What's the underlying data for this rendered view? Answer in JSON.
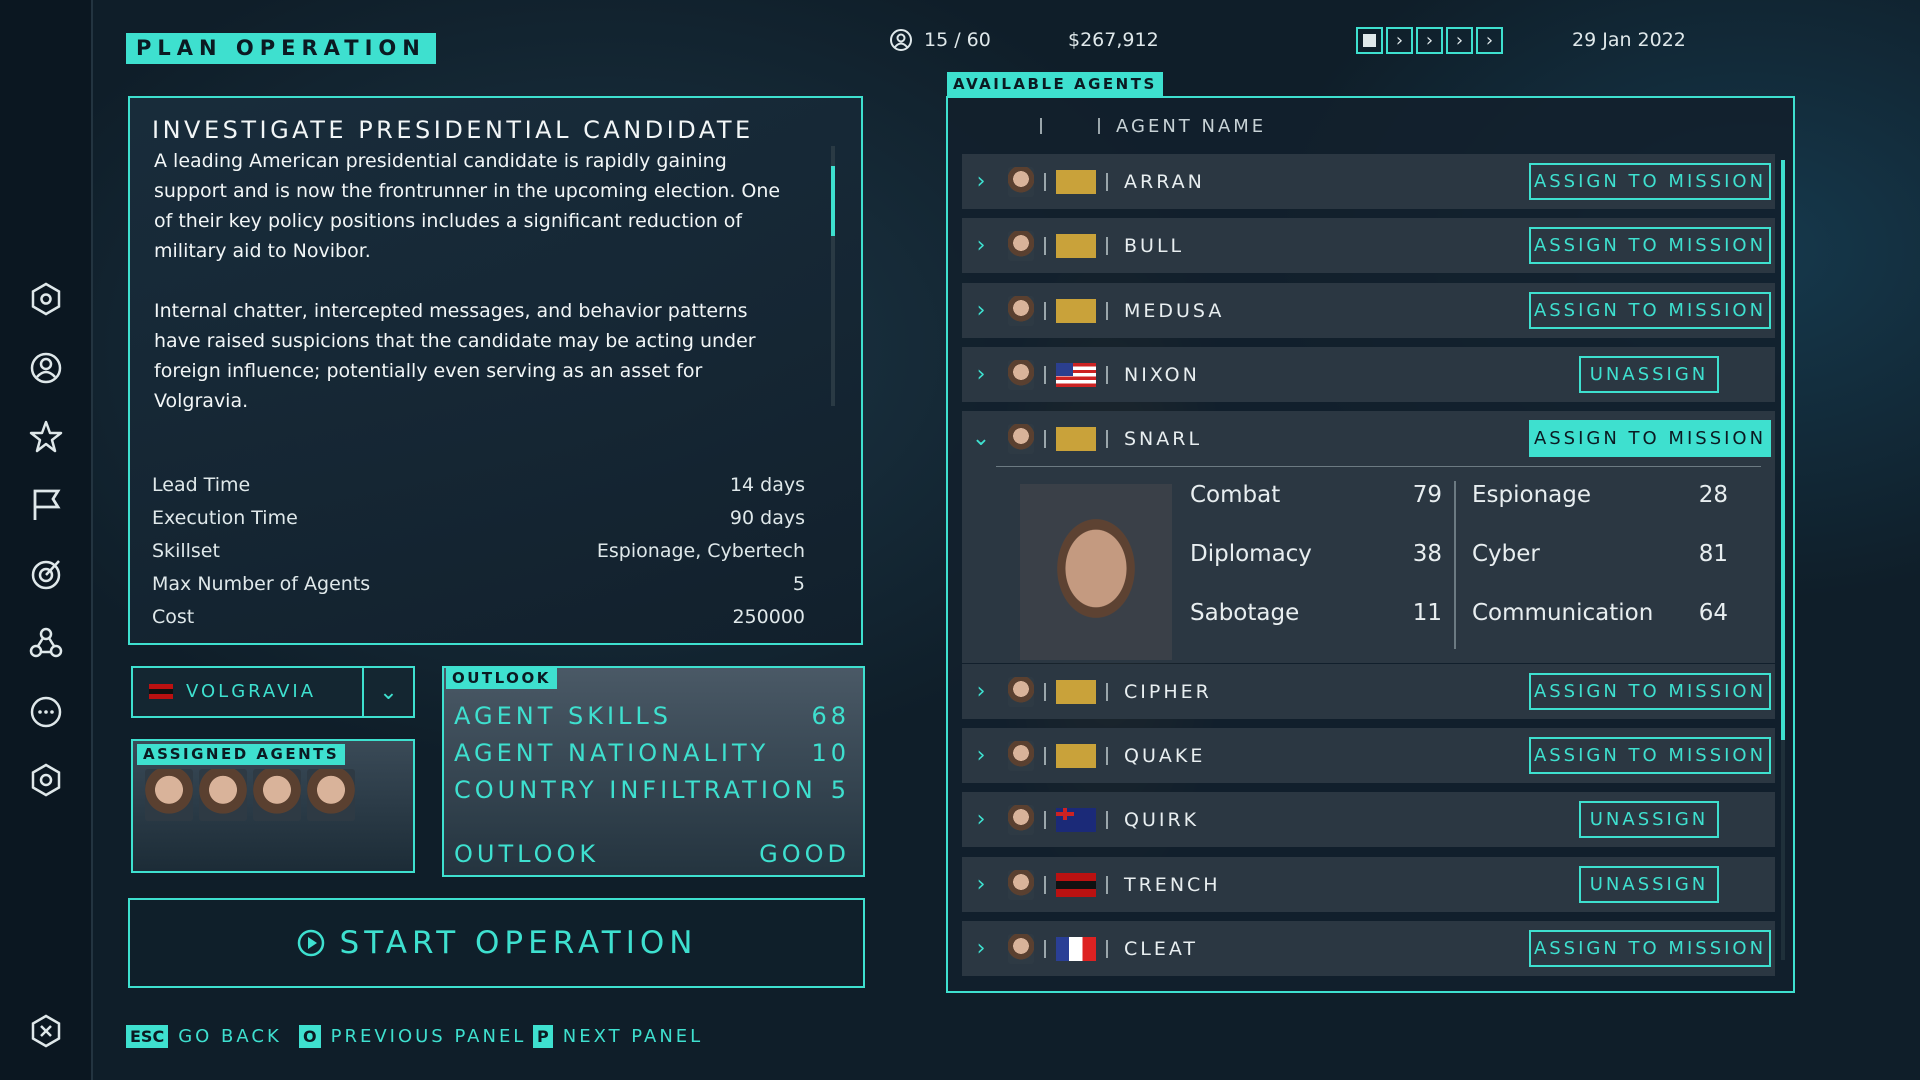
{
  "title": "PLAN OPERATION",
  "header": {
    "agents_count": "15 / 60",
    "money": "$267,912",
    "date": "29 Jan 2022"
  },
  "mission": {
    "title": "INVESTIGATE PRESIDENTIAL CANDIDATE",
    "description": [
      "A leading American presidential candidate is rapidly gaining support and is now the frontrunner in the upcoming election. One of their key policy positions includes a significant reduction of military aid to Novibor.",
      "Internal chatter, intercepted messages, and behavior patterns have raised suspicions that the candidate may be acting under foreign influence; potentially even serving as an asset for Volgravia."
    ],
    "details": [
      {
        "label": "Lead Time",
        "value": "14 days"
      },
      {
        "label": "Execution Time",
        "value": "90 days"
      },
      {
        "label": "Skillset",
        "value": "Espionage, Cybertech"
      },
      {
        "label": "Max Number of Agents",
        "value": "5"
      },
      {
        "label": "Cost",
        "value": "250000"
      }
    ]
  },
  "country": {
    "selected": "VOLGRAVIA"
  },
  "assigned_agents": {
    "label": "ASSIGNED AGENTS",
    "count": 4
  },
  "outlook": {
    "label": "OUTLOOK",
    "rows": [
      {
        "label": "AGENT SKILLS",
        "value": "68"
      },
      {
        "label": "AGENT NATIONALITY",
        "value": "10"
      },
      {
        "label": "COUNTRY INFILTRATION",
        "value": "5"
      }
    ],
    "summary_label": "OUTLOOK",
    "summary_value": "GOOD"
  },
  "start_label": "START OPERATION",
  "hints": [
    {
      "key": "ESC",
      "label": "GO BACK"
    },
    {
      "key": "O",
      "label": "PREVIOUS PANEL"
    },
    {
      "key": "P",
      "label": "NEXT PANEL"
    }
  ],
  "agents_panel": {
    "label": "AVAILABLE AGENTS",
    "column_header": "AGENT NAME",
    "assign_label": "ASSIGN TO MISSION",
    "unassign_label": "UNASSIGN",
    "rows": [
      {
        "name": "ARRAN",
        "flag": "volgravia-eagle",
        "action": "assign"
      },
      {
        "name": "BULL",
        "flag": "volgravia-eagle",
        "action": "assign"
      },
      {
        "name": "MEDUSA",
        "flag": "volgravia-eagle",
        "action": "assign"
      },
      {
        "name": "NIXON",
        "flag": "usa",
        "action": "unassign"
      },
      {
        "name": "SNARL",
        "flag": "volgravia-eagle",
        "action": "assign",
        "expanded": true
      },
      {
        "name": "CIPHER",
        "flag": "volgravia-eagle",
        "action": "assign"
      },
      {
        "name": "QUAKE",
        "flag": "volgravia-eagle",
        "action": "assign"
      },
      {
        "name": "QUIRK",
        "flag": "australia",
        "action": "unassign"
      },
      {
        "name": "TRENCH",
        "flag": "volgravia-red",
        "action": "unassign"
      },
      {
        "name": "CLEAT",
        "flag": "france",
        "action": "assign"
      }
    ],
    "snarl_stats": [
      {
        "label": "Combat",
        "value": "79"
      },
      {
        "label": "Espionage",
        "value": "28"
      },
      {
        "label": "Diplomacy",
        "value": "38"
      },
      {
        "label": "Cyber",
        "value": "81"
      },
      {
        "label": "Sabotage",
        "value": "11"
      },
      {
        "label": "Communication",
        "value": "64"
      }
    ]
  },
  "colors": {
    "accent": "#3ee0cf",
    "background": "#0f1e29"
  }
}
